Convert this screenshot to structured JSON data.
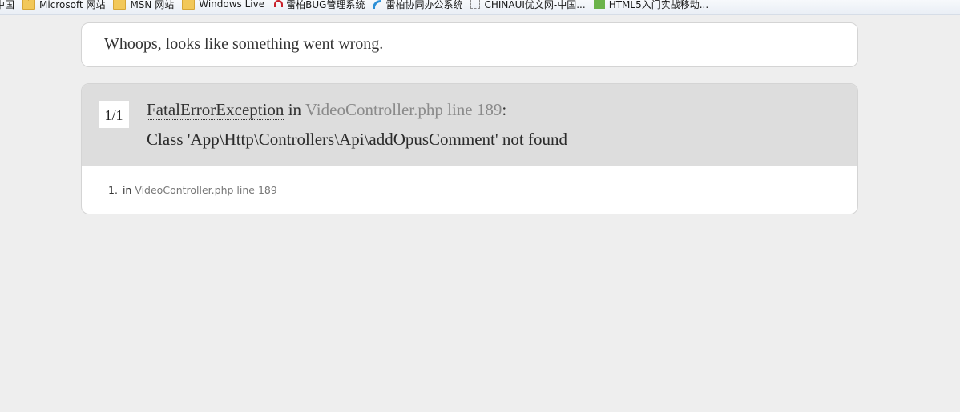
{
  "bookmarks": [
    {
      "label": "中国",
      "icon": "none"
    },
    {
      "label": "Microsoft 网站",
      "icon": "folder-icon"
    },
    {
      "label": "MSN 网站",
      "icon": "folder-icon"
    },
    {
      "label": "Windows Live",
      "icon": "folder-icon"
    },
    {
      "label": "雷柏BUG管理系统",
      "icon": "bug-icon"
    },
    {
      "label": "雷柏协同办公系统",
      "icon": "rss-icon"
    },
    {
      "label": "CHINAUI优文网-中国...",
      "icon": "dotted-icon"
    },
    {
      "label": "HTML5入门实战移动...",
      "icon": "green-icon"
    }
  ],
  "header": {
    "message": "Whoops, looks like something went wrong."
  },
  "exception": {
    "counter": "1/1",
    "class_name": "FatalErrorException",
    "in_word": " in ",
    "file": "VideoController.php line 189",
    "colon": ":",
    "message": "Class 'App\\Http\\Controllers\\Api\\addOpusComment' not found"
  },
  "trace": [
    {
      "num": "1.",
      "in_word": "in ",
      "file": "VideoController.php line 189"
    }
  ],
  "colors": {
    "background": "#eeeeee",
    "exception_header": "#dddddd",
    "file_text": "#8a8a8a"
  }
}
